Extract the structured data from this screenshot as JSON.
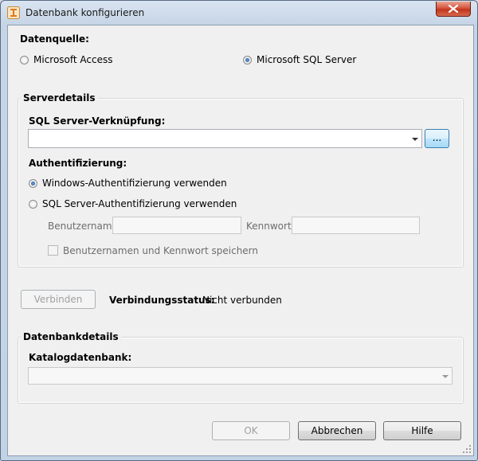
{
  "window": {
    "title": "Datenbank konfigurieren"
  },
  "datasource": {
    "label": "Datenquelle:",
    "options": [
      {
        "label": "Microsoft Access",
        "selected": false
      },
      {
        "label": "Microsoft SQL Server",
        "selected": true
      }
    ]
  },
  "server": {
    "group_title": "Serverdetails",
    "connection_label": "SQL Server-Verknüpfung:",
    "connection_value": "",
    "browse_label": "...",
    "auth_label": "Authentifizierung:",
    "auth_options": [
      {
        "label": "Windows-Authentifizierung verwenden",
        "selected": true
      },
      {
        "label": "SQL Server-Authentifizierung verwenden",
        "selected": false
      }
    ],
    "username_label": "Benutzername",
    "username_value": "",
    "password_label": "Kennwort",
    "password_value": "",
    "remember_label": "Benutzernamen und Kennwort speichern",
    "remember_checked": false
  },
  "connection": {
    "connect_label": "Verbinden",
    "status_label": "Verbindungsstatus:",
    "status_value": "Nicht verbunden"
  },
  "database": {
    "group_title": "Datenbankdetails",
    "catalog_label": "Katalogdatenbank:",
    "catalog_value": ""
  },
  "footer": {
    "ok_label": "OK",
    "cancel_label": "Abbrechen",
    "help_label": "Hilfe"
  },
  "colors": {
    "accent": "#1c4f8f",
    "close_button": "#c1341c",
    "dialog_background": "#f0f0f0"
  }
}
